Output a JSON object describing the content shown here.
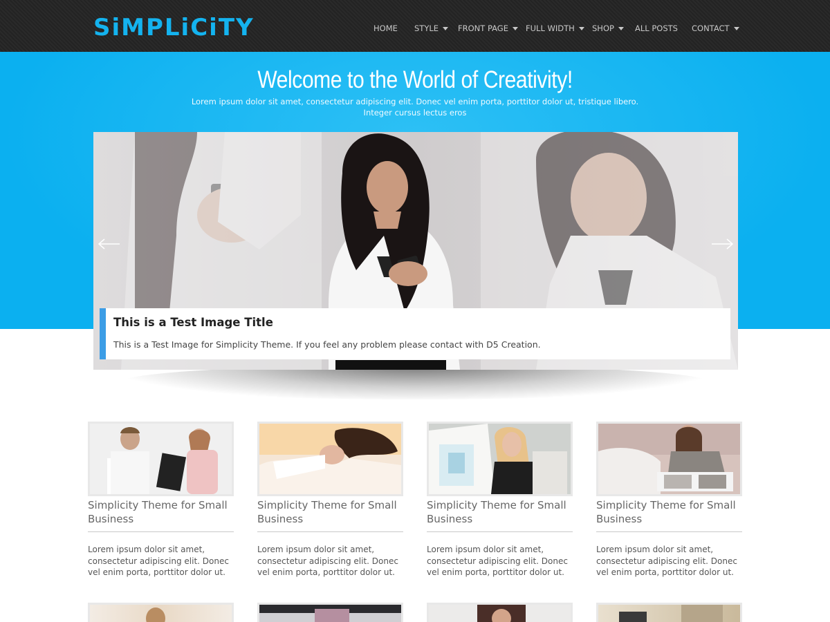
{
  "site": {
    "logo": "SiMPLiCiTY"
  },
  "nav": {
    "items": [
      {
        "label": "HOME",
        "dropdown": false
      },
      {
        "label": "STYLE",
        "dropdown": true
      },
      {
        "label": "FRONT PAGE",
        "dropdown": true
      },
      {
        "label": "FULL WIDTH",
        "dropdown": true
      },
      {
        "label": "SHOP",
        "dropdown": true
      },
      {
        "label": "ALL POSTS",
        "dropdown": false
      },
      {
        "label": "CONTACT",
        "dropdown": true
      }
    ]
  },
  "hero": {
    "title": "Welcome to the World of Creativity!",
    "subtitle": "Lorem ipsum dolor sit amet, consectetur adipiscing elit. Donec vel enim porta, porttitor dolor ut, tristique libero. Integer cursus lectus eros"
  },
  "slider": {
    "prev_icon": "arrow-left-icon",
    "next_icon": "arrow-right-icon",
    "caption_title": "This is a Test Image Title",
    "caption_text": "This is a Test Image for Simplicity Theme. If you feel any problem please contact with D5 Creation."
  },
  "posts": [
    {
      "title": "Simplicity Theme for Small Business",
      "excerpt": "Lorem ipsum dolor sit amet, consectetur adipiscing elit. Donec vel enim porta, porttitor dolor ut."
    },
    {
      "title": "Simplicity Theme for Small Business",
      "excerpt": "Lorem ipsum dolor sit amet, consectetur adipiscing elit. Donec vel enim porta, porttitor dolor ut."
    },
    {
      "title": "Simplicity Theme for Small Business",
      "excerpt": "Lorem ipsum dolor sit amet, consectetur adipiscing elit. Donec vel enim porta, porttitor dolor ut."
    },
    {
      "title": "Simplicity Theme for Small Business",
      "excerpt": "Lorem ipsum dolor sit amet, consectetur adipiscing elit. Donec vel enim porta, porttitor dolor ut."
    }
  ],
  "colors": {
    "accent": "#0db2f2",
    "header": "#262626",
    "caption_bar": "#3c9de6"
  }
}
